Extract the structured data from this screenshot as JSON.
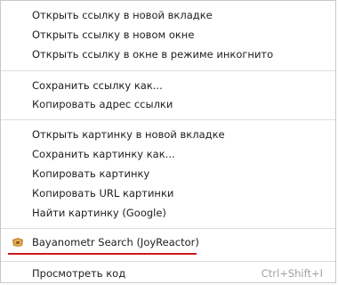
{
  "menu": {
    "items": [
      {
        "label": "Открыть ссылку в новой вкладке"
      },
      {
        "label": "Открыть ссылку в новом окне"
      },
      {
        "label": "Открыть ссылку в окне в режиме инкогнито"
      },
      {
        "label": "Сохранить ссылку как..."
      },
      {
        "label": "Копировать адрес ссылки"
      },
      {
        "label": "Открыть картинку в новой вкладке"
      },
      {
        "label": "Сохранить картинку как..."
      },
      {
        "label": "Копировать картинку"
      },
      {
        "label": "Копировать URL картинки"
      },
      {
        "label": "Найти картинку (Google)"
      },
      {
        "label": "Bayanometr Search (JoyReactor)",
        "icon": "extension-icon"
      },
      {
        "label": "Просмотреть код",
        "shortcut": "Ctrl+Shift+I"
      }
    ]
  },
  "colors": {
    "highlight_underline": "#d01818",
    "extension_icon": "#c98a2e"
  }
}
